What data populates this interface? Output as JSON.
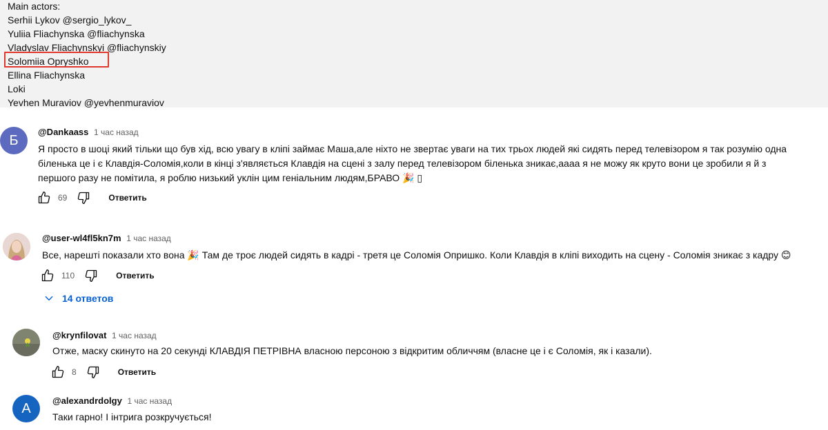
{
  "description": {
    "title": "Main actors:",
    "actors": [
      "Serhii Lykov  @sergio_lykov_",
      "Yuliia Fliachynska  @fliachynska",
      "Vladyslav Fliachynskyi @fliachynskiy",
      "Solomiia Opryshko",
      "Ellina Fliachynska",
      "Loki",
      "Yevhen Muraviov @yevhenmuraviov"
    ]
  },
  "comments": [
    {
      "avatar_letter": "Б",
      "avatar_color": "#5c6bc0",
      "author": "@Dankaass",
      "time": "1 час назад",
      "text_line1": "Я просто в шоці який тільки що був хід, всю увагу в кліпі займає Маша,але ніхто не звертає уваги на тих трьох людей які сидять перед телевізором я так розумію одна",
      "text_line2": "біленька це і є Клавдія-Соломія,коли в кінці з'являється Клавдія на сцені з залу перед телевізором біленька зникає,аааа я не можу як круто вони це зробили я й з",
      "text_line3": "першого разу не помітила, я роблю низький уклін цим геніальним людям,БРАВО 🎉 ▯",
      "likes": "69",
      "reply_label": "Ответить"
    },
    {
      "author": "@user-wl4fl5kn7m",
      "time": "1 час назад",
      "text": "Все, нарешті показали хто вона 🎉  Там де троє людей сидять в кадрі - третя це Соломія Опришко. Коли Клавдія в кліпі виходить на сцену - Соломія зникає з кадру 😊",
      "likes": "110",
      "reply_label": "Ответить",
      "replies_label": "14 ответов"
    },
    {
      "author": "@krynfilovat",
      "time": "1 час назад",
      "text": "Отже, маску скинуто на 20 секунді КЛАВДІЯ ПЕТРІВНА власною персоною з відкритим обличчям (власне це і є Соломія, як і казали).",
      "likes": "8",
      "reply_label": "Ответить"
    },
    {
      "avatar_letter": "A",
      "avatar_color": "#1565c0",
      "author": "@alexandrdolgy",
      "time": "1 час назад",
      "text": "Таки гарно! І інтрига розкручується!"
    }
  ],
  "icons": {
    "like": "thumbs-up-icon",
    "dislike": "thumbs-down-icon",
    "expand": "chevron-down-icon"
  },
  "colors": {
    "highlight": "#e0362c",
    "link": "#065fd4",
    "desc_bg": "#f2f2f2"
  }
}
